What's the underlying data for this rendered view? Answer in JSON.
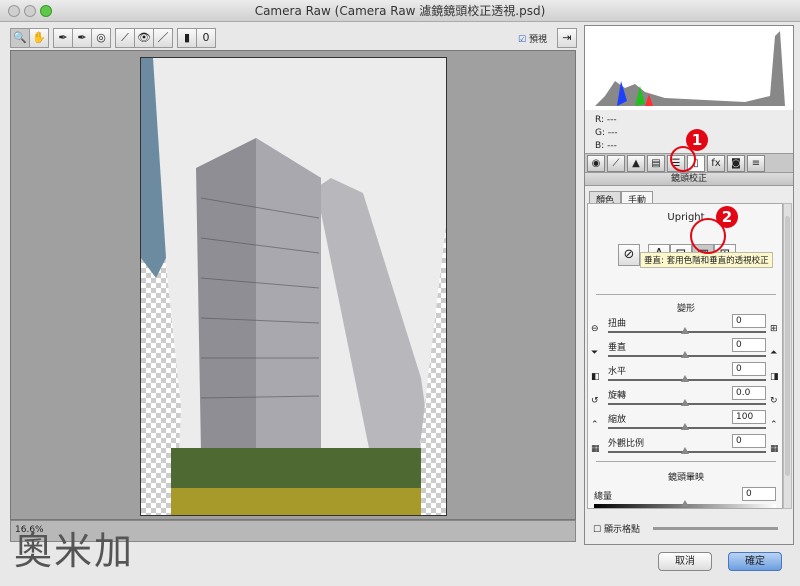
{
  "window": {
    "title": "Camera Raw (Camera Raw 濾鏡鏡頭校正透視.psd)"
  },
  "toolbar": {
    "tools": [
      "zoom-icon",
      "hand-icon",
      "white-balance-icon",
      "color-sampler-icon",
      "targeted-adjustment-icon",
      "straighten-icon",
      "red-eye-icon",
      "brush-icon",
      "graduated-filter-icon",
      "radial-filter-icon"
    ],
    "glyphs": [
      "🔍",
      "✋",
      "✒",
      "✒",
      "◎",
      "⟋",
      "👁",
      "／",
      "▮",
      "0"
    ],
    "preview_label": "預視",
    "preview_checked": true
  },
  "status": {
    "zoom": "16.6%"
  },
  "info": {
    "r_label": "R:",
    "g_label": "G:",
    "b_label": "B:",
    "r": "---",
    "g": "---",
    "b": "---"
  },
  "panel": {
    "title": "鏡頭校正",
    "tabs": [
      "顏色",
      "手動"
    ],
    "active_tab": "手動",
    "upright_title": "Upright",
    "upright_buttons": [
      {
        "name": "off",
        "glyph": "⊘"
      },
      {
        "name": "auto",
        "glyph": "A"
      },
      {
        "name": "level",
        "glyph": "⊟"
      },
      {
        "name": "vertical",
        "glyph": "▥"
      },
      {
        "name": "full",
        "glyph": "⊞"
      }
    ],
    "tooltip": "垂直: 套用色階和垂直的透視校正",
    "transform_title": "變形",
    "sliders": [
      {
        "label": "扭曲",
        "value": "0",
        "icon_l": "⊖",
        "icon_r": "⊞"
      },
      {
        "label": "垂直",
        "value": "0",
        "icon_l": "⏷",
        "icon_r": "⏶"
      },
      {
        "label": "水平",
        "value": "0",
        "icon_l": "◧",
        "icon_r": "◨"
      },
      {
        "label": "旋轉",
        "value": "0.0",
        "icon_l": "↺",
        "icon_r": "↻"
      },
      {
        "label": "縮放",
        "value": "100",
        "icon_l": "⌃",
        "icon_r": "⌃"
      },
      {
        "label": "外觀比例",
        "value": "0",
        "icon_l": "▦",
        "icon_r": "▦"
      }
    ],
    "vignette_title": "鏡頭暈映",
    "vignette_amount_label": "總量",
    "vignette_amount": "0",
    "grid_label": "顯示格點"
  },
  "buttons": {
    "cancel": "取消",
    "ok": "確定"
  },
  "annotations": [
    "1",
    "2"
  ],
  "watermark": "奧米加",
  "colors": {
    "accent": "#e30613",
    "ok_button": "#6d9ee0"
  }
}
